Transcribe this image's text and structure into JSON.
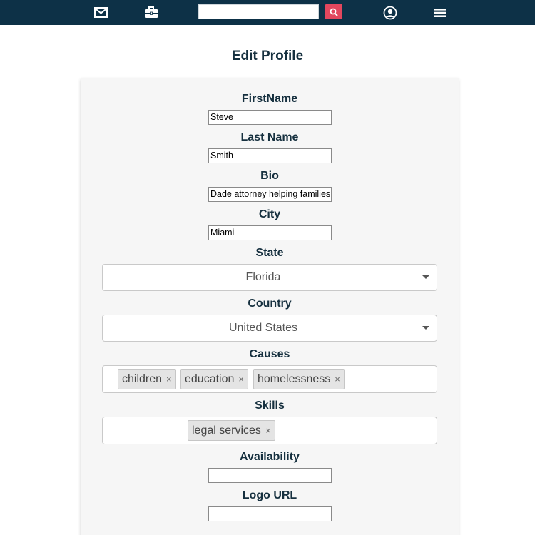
{
  "nav": {
    "search": {
      "value": "",
      "placeholder": ""
    },
    "icons": [
      "envelope-icon",
      "briefcase-icon",
      "search-icon",
      "user-circle-icon",
      "menu-icon"
    ]
  },
  "page": {
    "title": "Edit Profile"
  },
  "form": {
    "first_name": {
      "label": "FirstName",
      "value": "Steve"
    },
    "last_name": {
      "label": "Last Name",
      "value": "Smith"
    },
    "bio": {
      "label": "Bio",
      "value": "Dade attorney helping families"
    },
    "city": {
      "label": "City",
      "value": "Miami"
    },
    "state": {
      "label": "State",
      "value": "Florida"
    },
    "country": {
      "label": "Country",
      "value": "United States"
    },
    "causes": {
      "label": "Causes",
      "tags": [
        "children",
        "education",
        "homelessness"
      ]
    },
    "skills": {
      "label": "Skills",
      "tags": [
        "legal services"
      ]
    },
    "availability": {
      "label": "Availability",
      "value": ""
    },
    "logo_url": {
      "label": "Logo URL",
      "value": ""
    },
    "tag_remove_glyph": "×"
  },
  "colors": {
    "nav_bg": "#0d3147",
    "search_button": "#e2475e",
    "card_bg": "#f6f6f6",
    "heading": "#16303f"
  }
}
